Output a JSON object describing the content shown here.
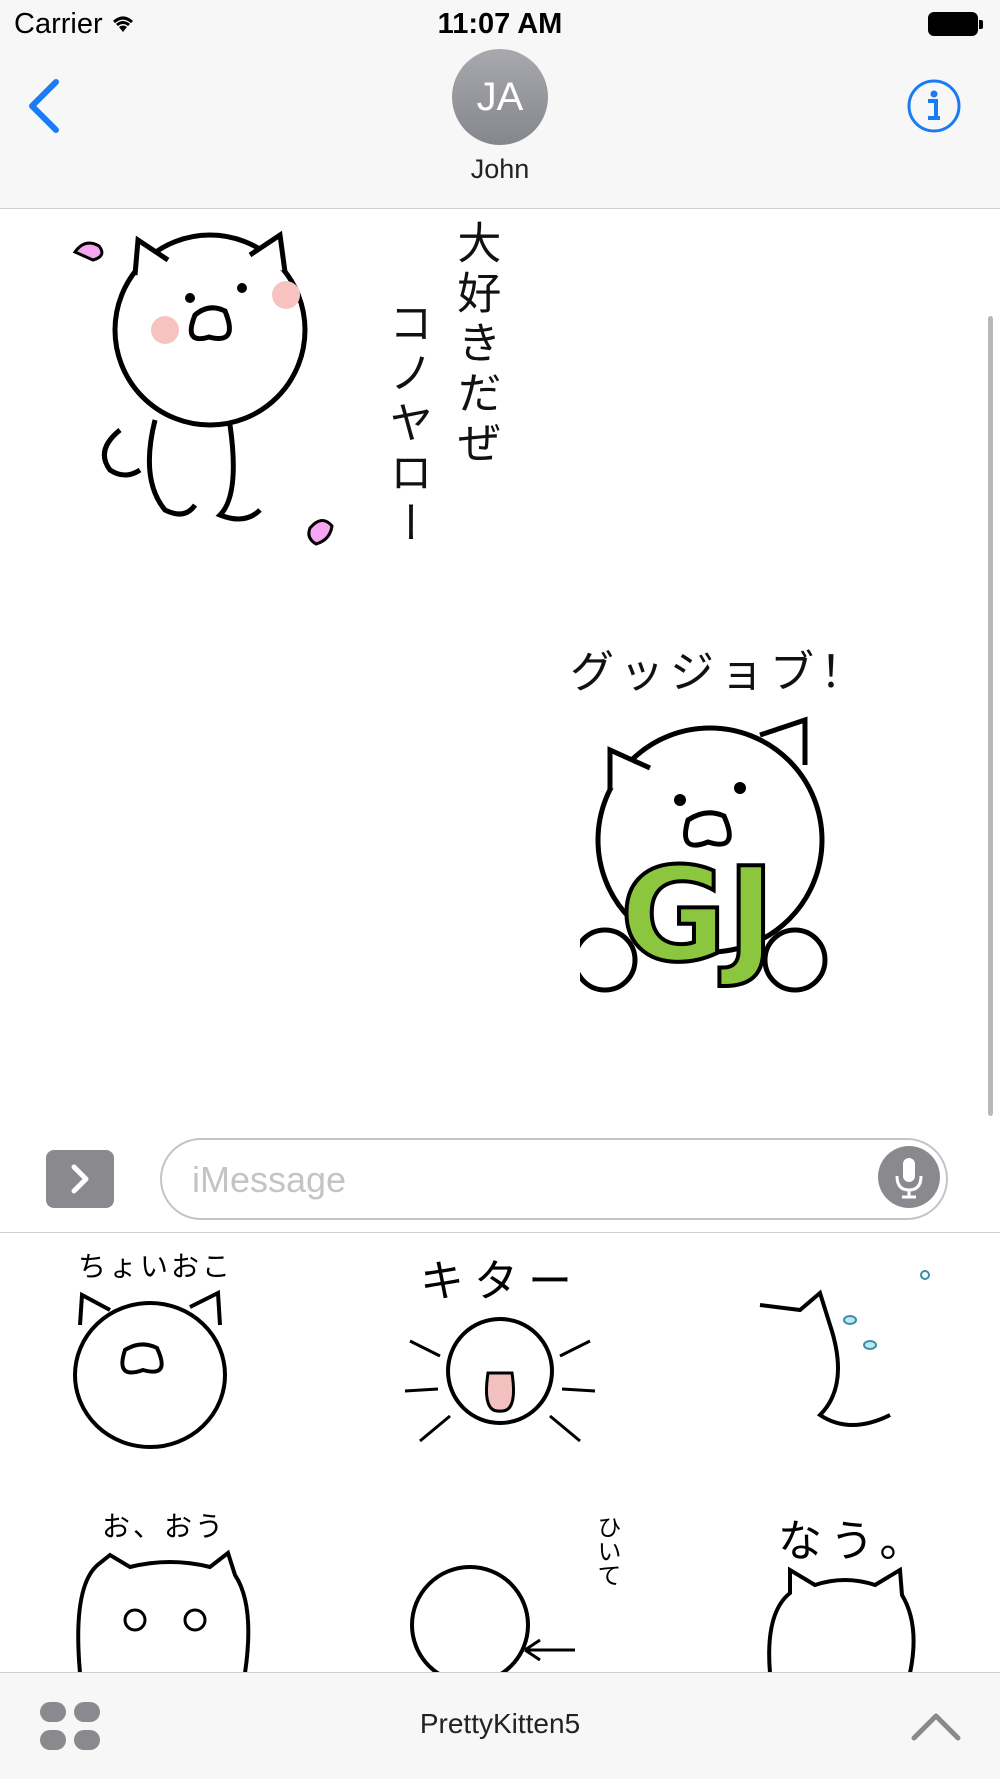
{
  "status_bar": {
    "carrier": "Carrier",
    "time": "11:07 AM",
    "wifi_icon": "wifi-icon",
    "battery_icon": "battery-icon"
  },
  "nav": {
    "back_icon": "chevron-left-icon",
    "avatar_initials": "JA",
    "contact_name": "John",
    "info_icon": "info-icon"
  },
  "conversation": {
    "stickers": [
      {
        "name": "love-cat-sticker",
        "text_col1": "大好きだぜ",
        "text_col2": "コノヤロー"
      },
      {
        "name": "good-job-cat-sticker",
        "caption": "グッジョブ！",
        "letters": "GJ"
      }
    ]
  },
  "input": {
    "placeholder": "iMessage",
    "value": "",
    "apps_icon": "chevron-right-icon",
    "mic_icon": "microphone-icon"
  },
  "sticker_drawer": {
    "stickers": [
      {
        "name": "sticker-choi-oko",
        "caption": "ちょいおこ"
      },
      {
        "name": "sticker-kita",
        "caption": "キター"
      },
      {
        "name": "sticker-dash",
        "caption": ""
      },
      {
        "name": "sticker-o-ou",
        "caption": "お、おう"
      },
      {
        "name": "sticker-hiite",
        "caption": "ひいて"
      },
      {
        "name": "sticker-nau",
        "caption": "なう。"
      }
    ],
    "pack_name": "PrettyKitten5",
    "grid_icon": "app-grid-icon",
    "expand_icon": "chevron-up-icon"
  },
  "colors": {
    "accent": "#1a7cf5",
    "gj_green": "#8cc63f",
    "gj_orange": "#f0b460",
    "heart_pink": "#f4a6f0",
    "cheek_pink": "#f7c3c1"
  }
}
